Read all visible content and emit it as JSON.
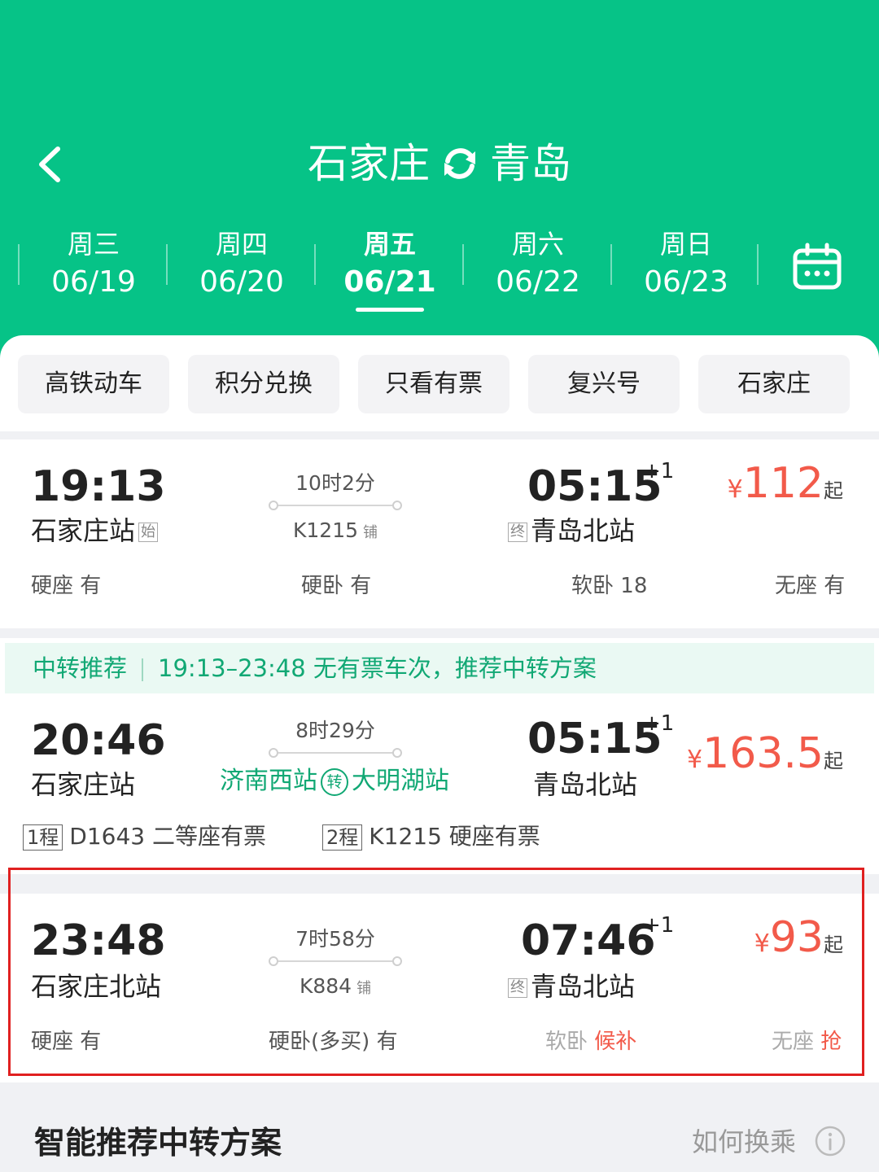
{
  "header": {
    "from": "石家庄",
    "to": "青岛",
    "dates": [
      {
        "weekday": "周三",
        "date": "06/19"
      },
      {
        "weekday": "周四",
        "date": "06/20"
      },
      {
        "weekday": "周五",
        "date": "06/21"
      },
      {
        "weekday": "周六",
        "date": "06/22"
      },
      {
        "weekday": "周日",
        "date": "06/23"
      }
    ],
    "active_date_index": 2,
    "icons": {
      "back": "chevron-left-icon",
      "swap": "swap-icon",
      "calendar": "calendar-icon"
    }
  },
  "filters": [
    "高铁动车",
    "积分兑换",
    "只看有票",
    "复兴号",
    "石家庄"
  ],
  "trains": [
    {
      "dep_time": "19:13",
      "dep_station": "石家庄站",
      "dep_tag": "始",
      "duration": "10时2分",
      "train_no": "K1215",
      "sleeper_tag": "铺",
      "arr_time": "05:15",
      "arr_plus": "+1",
      "arr_station": "青岛北站",
      "arr_tag": "终",
      "price_currency": "¥",
      "price": "112",
      "price_suffix": "起",
      "seats": [
        {
          "name": "硬座",
          "status": "有"
        },
        {
          "name": "硬卧",
          "status": "有"
        },
        {
          "name": "软卧",
          "status": "18"
        },
        {
          "name": "无座",
          "status": "有"
        }
      ]
    },
    {
      "dep_time": "23:48",
      "dep_station": "石家庄北站",
      "duration": "7时58分",
      "train_no": "K884",
      "sleeper_tag": "铺",
      "arr_time": "07:46",
      "arr_plus": "+1",
      "arr_station": "青岛北站",
      "arr_tag": "终",
      "price_currency": "¥",
      "price": "93",
      "price_suffix": "起",
      "seats": [
        {
          "name": "硬座",
          "status": "有"
        },
        {
          "name": "硬卧(多买)",
          "status": "有"
        },
        {
          "name": "软卧",
          "status": "候补"
        },
        {
          "name": "无座",
          "status": "抢"
        }
      ]
    }
  ],
  "transfer": {
    "banner_label": "中转推荐",
    "banner_text": "19:13–23:48 无有票车次，推荐中转方案",
    "dep_time": "20:46",
    "dep_station": "石家庄站",
    "duration": "8时29分",
    "via_1": "济南西站",
    "via_icon_label": "转",
    "via_2": "大明湖站",
    "arr_time": "05:15",
    "arr_plus": "+1",
    "arr_station": "青岛北站",
    "price_currency": "¥",
    "price": "163.5",
    "price_suffix": "起",
    "legs": [
      {
        "tag": "1程",
        "text": "D1643 二等座有票"
      },
      {
        "tag": "2程",
        "text": "K1215 硬座有票"
      }
    ]
  },
  "footer": {
    "title": "智能推荐中转方案",
    "how_link": "如何换乘",
    "info_icon": "info-icon"
  }
}
